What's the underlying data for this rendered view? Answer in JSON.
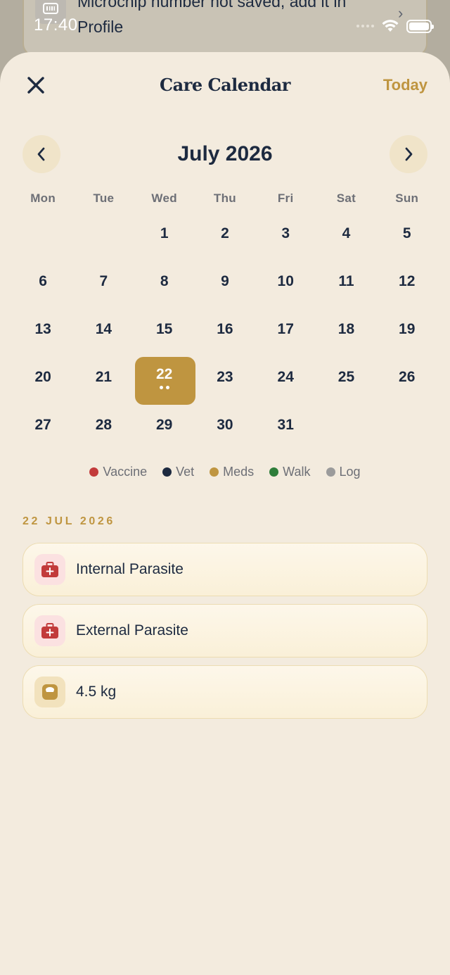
{
  "background": {
    "notice_line1": "Microchip number not saved, add it in",
    "notice_line2": "Profile"
  },
  "status_bar": {
    "time": "17:40"
  },
  "header": {
    "title": "Care Calendar",
    "today_label": "Today"
  },
  "calendar": {
    "month_label": "July 2026",
    "weekdays": [
      "Mon",
      "Tue",
      "Wed",
      "Thu",
      "Fri",
      "Sat",
      "Sun"
    ],
    "weeks": [
      [
        "",
        "",
        "1",
        "2",
        "3",
        "4",
        "5"
      ],
      [
        "6",
        "7",
        "8",
        "9",
        "10",
        "11",
        "12"
      ],
      [
        "13",
        "14",
        "15",
        "16",
        "17",
        "18",
        "19"
      ],
      [
        "20",
        "21",
        "22",
        "23",
        "24",
        "25",
        "26"
      ],
      [
        "27",
        "28",
        "29",
        "30",
        "31",
        "",
        ""
      ]
    ],
    "selected_day": "22"
  },
  "legend": [
    {
      "label": "Vaccine",
      "color": "#c23b3b"
    },
    {
      "label": "Vet",
      "color": "#1d2a40"
    },
    {
      "label": "Meds",
      "color": "#bf9540"
    },
    {
      "label": "Walk",
      "color": "#2e7d3a"
    },
    {
      "label": "Log",
      "color": "#9b9b9b"
    }
  ],
  "selected_date_label": "22 JUL 2026",
  "events": [
    {
      "label": "Internal Parasite",
      "icon": "first-aid-kit-icon"
    },
    {
      "label": "External Parasite",
      "icon": "first-aid-kit-icon"
    },
    {
      "label": "4.5 kg",
      "icon": "weight-scale-icon"
    }
  ],
  "colors": {
    "accent": "#bf9540",
    "sheet_bg": "#f3ebde",
    "navy": "#1d2a40"
  }
}
